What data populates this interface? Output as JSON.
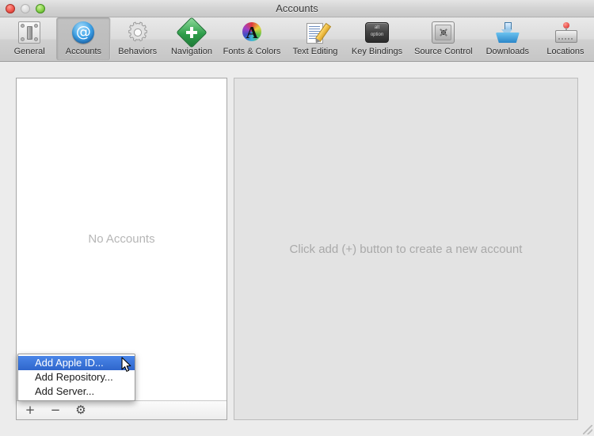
{
  "window": {
    "title": "Accounts",
    "traffic_lights": [
      {
        "name": "close",
        "color": "#f0564c",
        "enabled": true
      },
      {
        "name": "minimize",
        "color": "#dcdcdc",
        "enabled": false
      },
      {
        "name": "zoom",
        "color": "#86d14a",
        "enabled": true
      }
    ]
  },
  "toolbar": {
    "selected": "Accounts",
    "items": [
      {
        "label": "General",
        "icon": "general-icon"
      },
      {
        "label": "Accounts",
        "icon": "accounts-at-icon"
      },
      {
        "label": "Behaviors",
        "icon": "gear-icon"
      },
      {
        "label": "Navigation",
        "icon": "navigation-arrows-icon"
      },
      {
        "label": "Fonts & Colors",
        "icon": "fonts-colors-icon"
      },
      {
        "label": "Text Editing",
        "icon": "text-editing-icon"
      },
      {
        "label": "Key Bindings",
        "icon": "key-bindings-icon"
      },
      {
        "label": "Source Control",
        "icon": "safe-icon"
      },
      {
        "label": "Downloads",
        "icon": "downloads-icon"
      },
      {
        "label": "Locations",
        "icon": "locations-disk-icon"
      }
    ]
  },
  "key_icon": {
    "line1": "alt",
    "line2": "option"
  },
  "left_panel": {
    "empty_message": "No Accounts",
    "bottom_bar": [
      {
        "name": "add-button",
        "glyph": "+"
      },
      {
        "name": "remove-button",
        "glyph": "−"
      },
      {
        "name": "actions-button",
        "glyph": "⚙"
      }
    ]
  },
  "right_panel": {
    "hint": "Click add (+) button to create a new account"
  },
  "popup_menu": {
    "items": [
      {
        "label": "Add Apple ID...",
        "highlighted": true
      },
      {
        "label": "Add Repository...",
        "highlighted": false
      },
      {
        "label": "Add Server...",
        "highlighted": false
      }
    ],
    "highlight_color": "#2f66cc"
  }
}
